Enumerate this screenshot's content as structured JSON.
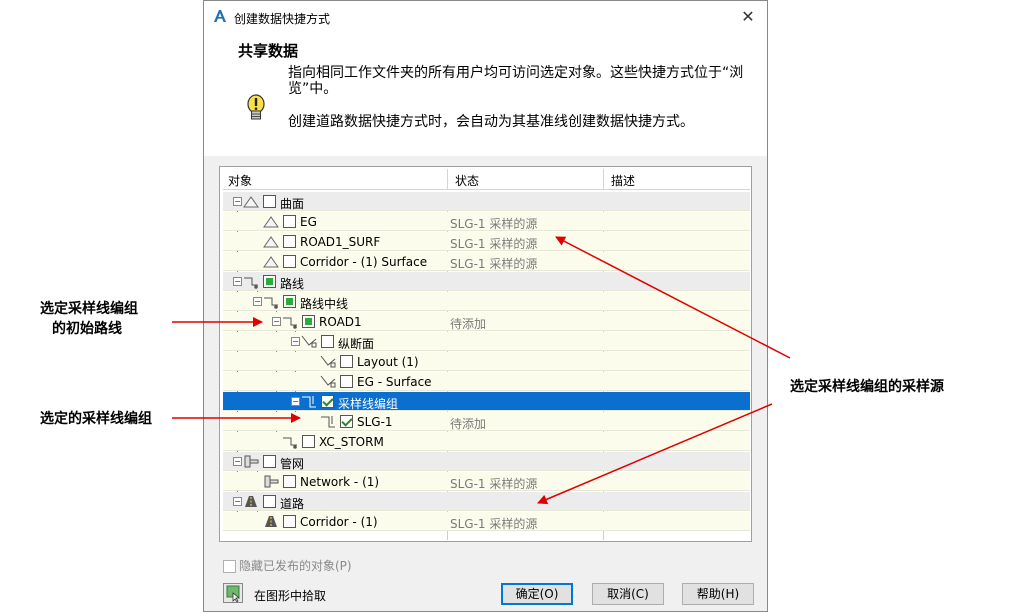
{
  "dialog": {
    "title": "创建数据快捷方式",
    "heading": "共享数据",
    "info_line1": "指向相同工作文件夹的所有用户均可访问选定对象。这些快捷方式位于“浏览”中。",
    "info_line2": "创建道路数据快捷方式时，会自动为其基准线创建数据快捷方式。"
  },
  "columns": [
    "对象",
    "状态",
    "描述"
  ],
  "tree": [
    {
      "name": "曲面",
      "status": "",
      "type": "cat"
    },
    {
      "name": "EG",
      "status": "SLG-1 采样的源",
      "type": "item"
    },
    {
      "name": "ROAD1_SURF",
      "status": "SLG-1 采样的源",
      "type": "item"
    },
    {
      "name": "Corridor - (1) Surface",
      "status": "SLG-1 采样的源",
      "type": "item"
    },
    {
      "name": "路线",
      "status": "",
      "type": "cat"
    },
    {
      "name": "路线中线",
      "status": "",
      "type": "item"
    },
    {
      "name": "ROAD1",
      "status": "待添加",
      "type": "item"
    },
    {
      "name": "纵断面",
      "status": "",
      "type": "item"
    },
    {
      "name": "Layout (1)",
      "status": "",
      "type": "item"
    },
    {
      "name": "EG - Surface",
      "status": "",
      "type": "item"
    },
    {
      "name": "采样线编组",
      "status": "",
      "type": "sel"
    },
    {
      "name": "SLG-1",
      "status": "待添加",
      "type": "item"
    },
    {
      "name": "XC_STORM",
      "status": "",
      "type": "item"
    },
    {
      "name": "管网",
      "status": "",
      "type": "cat"
    },
    {
      "name": "Network - (1)",
      "status": "SLG-1 采样的源",
      "type": "item"
    },
    {
      "name": "道路",
      "status": "",
      "type": "cat"
    },
    {
      "name": "Corridor - (1)",
      "status": "SLG-1 采样的源",
      "type": "item"
    }
  ],
  "hide_published_label": "隐藏已发布的对象(P)",
  "pick_label": "在图形中拾取",
  "buttons": {
    "ok": "确定(O)",
    "cancel": "取消(C)",
    "help": "帮助(H)"
  },
  "annotations": {
    "initial_alignment_line1": "选定采样线编组",
    "initial_alignment_line2": "的初始路线",
    "selected_group": "选定的采样线编组",
    "sample_source": "选定采样线编组的采样源"
  },
  "colors": {
    "selection": "#0a6fcf",
    "annotation_arrow": "#e00000",
    "checkbox_green": "#2bab3a"
  }
}
